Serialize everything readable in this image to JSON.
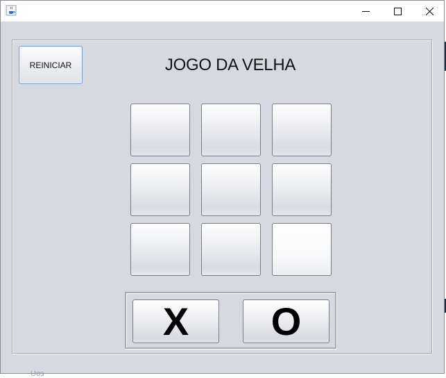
{
  "window": {
    "minimize_glyph": "—",
    "maximize_glyph": "☐",
    "close_glyph": "✕",
    "app_icon": "java-coffee-icon"
  },
  "game": {
    "title": "JOGO DA VELHA",
    "restart_label": "REINICIAR",
    "board": [
      "",
      "",
      "",
      "",
      "",
      "",
      "",
      "",
      ""
    ],
    "players": {
      "x_label": "X",
      "o_label": "O"
    }
  },
  "background": {
    "partial_text": "Uos"
  }
}
